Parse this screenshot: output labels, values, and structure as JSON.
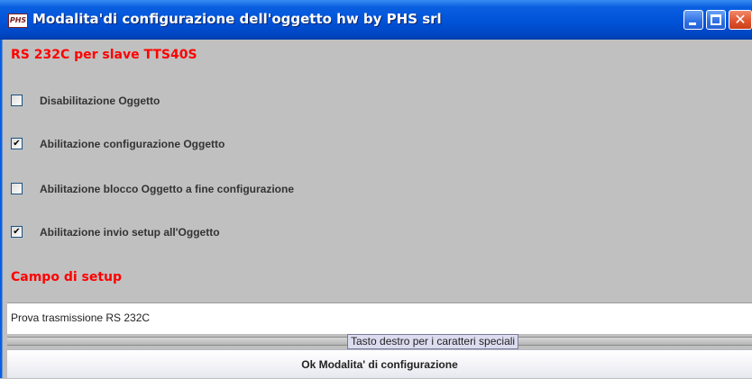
{
  "window": {
    "icon_text": "PHS",
    "title": "Modalita'di configurazione dell'oggetto hw by PHS srl",
    "controls": {
      "minimize_icon": "minimize-icon",
      "maximize_icon": "maximize-icon",
      "close_icon": "close-icon",
      "close_glyph": "✕"
    }
  },
  "section1": {
    "title": "RS 232C per slave TTS40S"
  },
  "options": [
    {
      "label": "Disabilitazione Oggetto",
      "checked": false,
      "mark": ""
    },
    {
      "label": "Abilitazione configurazione Oggetto",
      "checked": true,
      "mark": "✔"
    },
    {
      "label": "Abilitazione blocco Oggetto a fine configurazione",
      "checked": false,
      "mark": ""
    },
    {
      "label": "Abilitazione invio setup all'Oggetto",
      "checked": true,
      "mark": "✔"
    }
  ],
  "section2": {
    "title": "Campo di setup"
  },
  "setup_field": {
    "value": "Prova trasmissione RS 232C"
  },
  "hint": {
    "text": "Tasto destro per i caratteri speciali"
  },
  "ok_button": {
    "label": "Ok Modalita' di configurazione"
  },
  "colors": {
    "title_bar": "#0052d8",
    "section_title": "#ff0000",
    "background": "#c0c0c0"
  }
}
